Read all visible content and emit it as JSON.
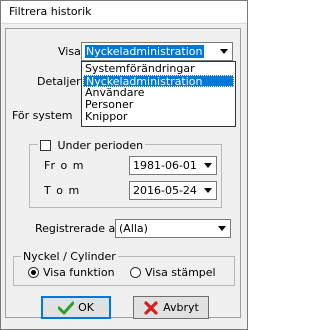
{
  "window": {
    "title": "Filtrera historik"
  },
  "visa": {
    "label": "Visa",
    "selected": "Nyckeladministration",
    "options": [
      "Systemförändringar",
      "Nyckeladministration",
      "Användare",
      "Personer",
      "Knippor"
    ]
  },
  "detaljer": {
    "label": "Detaljer"
  },
  "for_system": {
    "label": "För system"
  },
  "period": {
    "checkbox_label": "Under perioden",
    "from_label": "Fr o m",
    "from_value": "1981-06-01",
    "to_label": "T o m",
    "to_value": "2016-05-24"
  },
  "registrerade": {
    "label": "Registrerade av",
    "value": "(Alla)"
  },
  "nyckel_cylinder": {
    "legend": "Nyckel / Cylinder",
    "option1": "Visa funktion",
    "option2": "Visa stämpel",
    "selected": "Visa funktion"
  },
  "buttons": {
    "ok": "OK",
    "cancel": "Avbryt"
  },
  "colors": {
    "selection": "#0078d7",
    "ok_check": "#2e9e2e",
    "cancel_x": "#d21f1f"
  }
}
